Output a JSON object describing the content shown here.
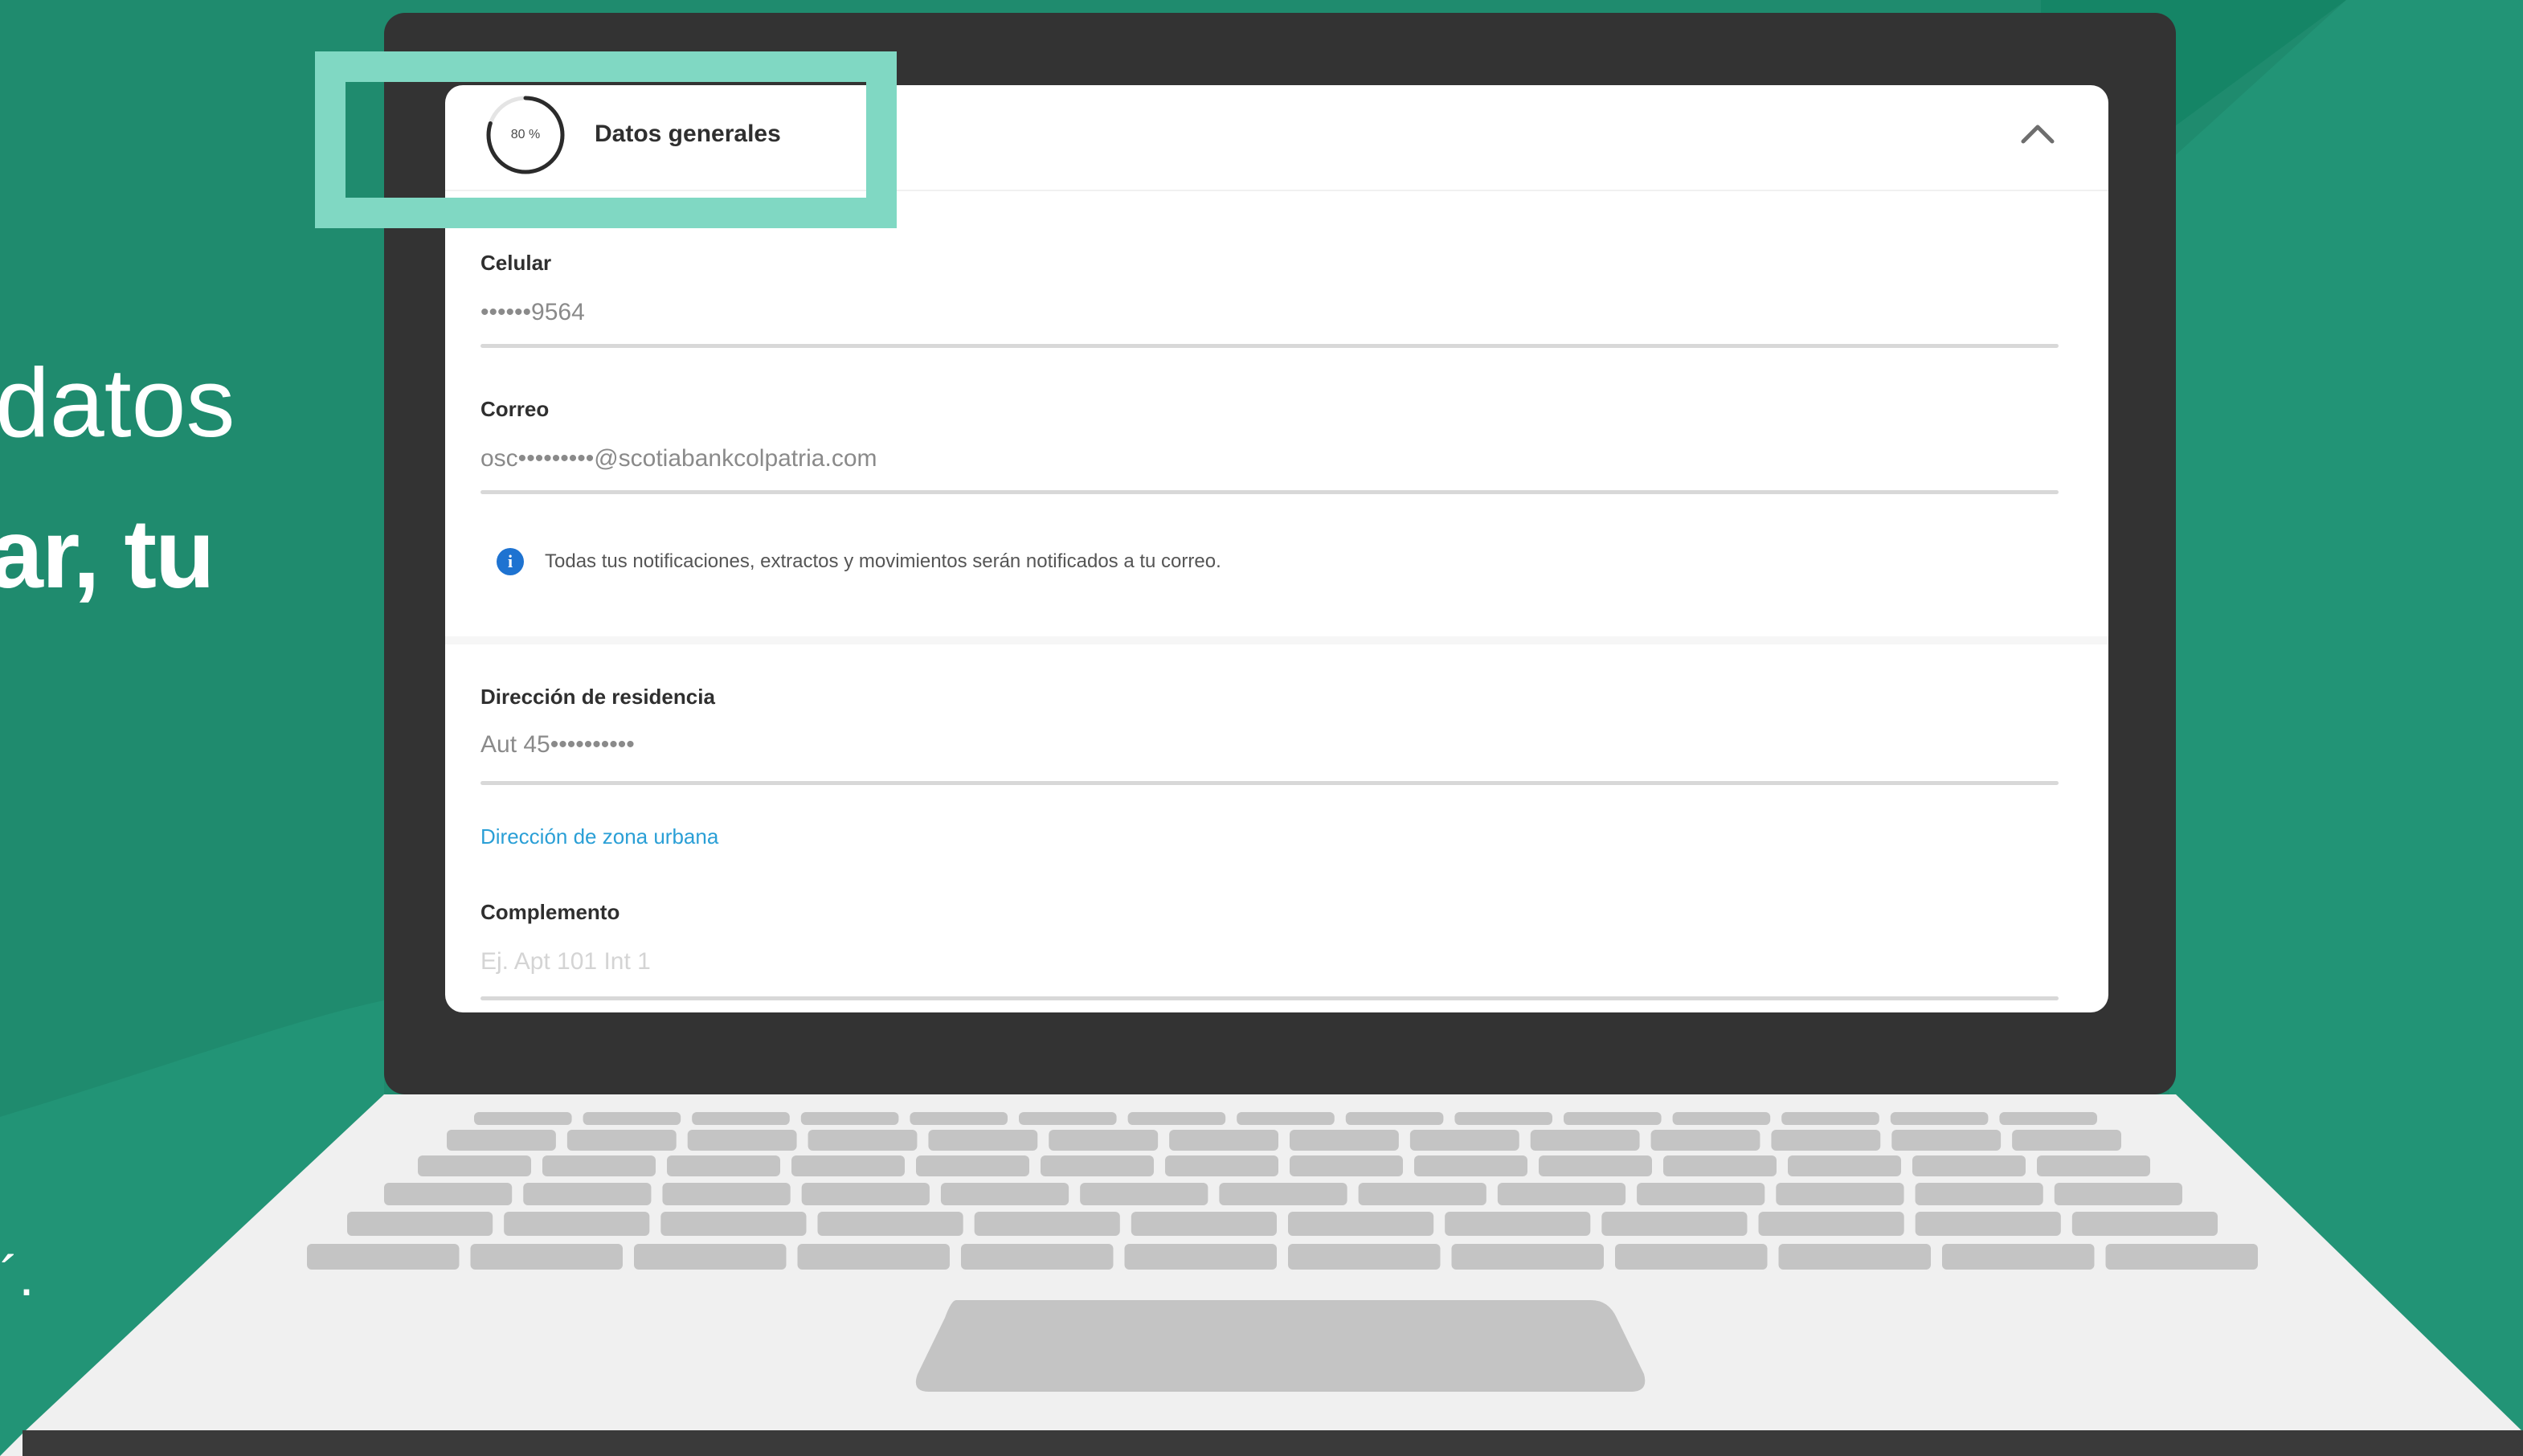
{
  "background": {
    "primary_color": "#1f8b6e",
    "accent_color": "#158a6a",
    "headline_line1": "datos",
    "headline_line2": "ar, tu",
    "side_glyph": "´."
  },
  "laptop": {
    "frame_color": "#333333",
    "keyboard_color": "#c4c4c4",
    "body_color": "#f0f0f0"
  },
  "panel": {
    "header": {
      "progress_percent": 80,
      "progress_label": "80 %",
      "title": "Datos generales",
      "collapse_icon": "chevron-up-icon"
    },
    "fields": {
      "phone": {
        "label": "Celular",
        "value": "••••••9564"
      },
      "email": {
        "label": "Correo",
        "value": "osc•••••••••@scotiabankcolpatria.com"
      },
      "notice": {
        "icon": "info-icon",
        "text": "Todas tus notificaciones, extractos y movimientos serán notificados a tu correo."
      },
      "address": {
        "label": "Dirección de residencia",
        "value": "Aut 45••••••••••"
      },
      "address_link": {
        "label": "Dirección de zona urbana"
      },
      "complement": {
        "label": "Complemento",
        "placeholder": "Ej. Apt 101 Int 1"
      }
    }
  },
  "highlight": {
    "color": "#80d8c3"
  }
}
